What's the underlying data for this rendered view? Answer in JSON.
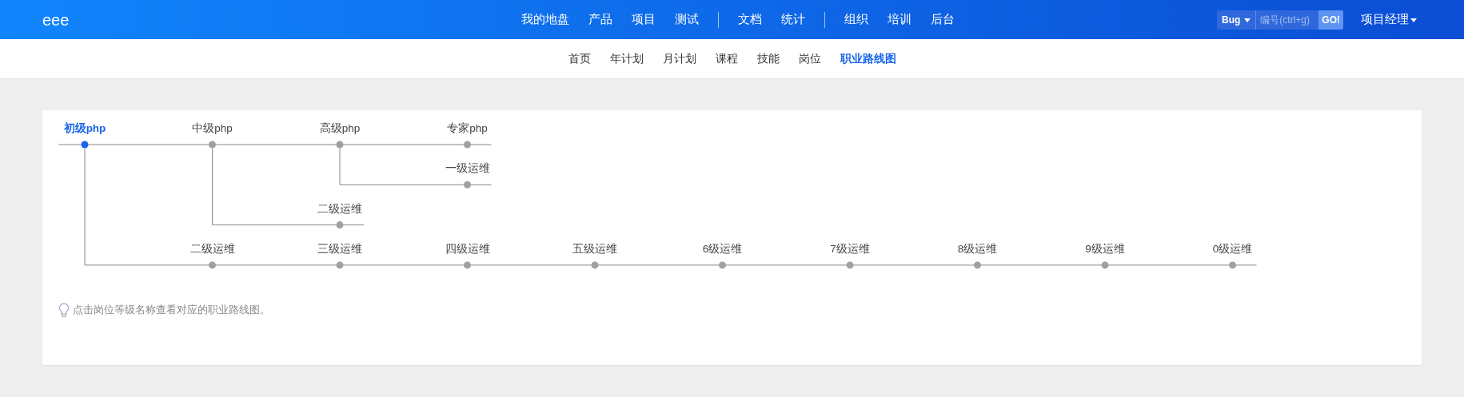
{
  "brand": "eee",
  "main_nav": [
    [
      "我的地盘",
      "产品",
      "项目",
      "测试"
    ],
    [
      "文档",
      "统计"
    ],
    [
      "组织",
      "培训",
      "后台"
    ]
  ],
  "search": {
    "type": "Bug",
    "placeholder": "编号(ctrl+g)",
    "button": "GO!"
  },
  "user_menu": "项目经理",
  "sub_nav": [
    {
      "label": "首页",
      "selected": false
    },
    {
      "label": "年计划",
      "selected": false
    },
    {
      "label": "月计划",
      "selected": false
    },
    {
      "label": "课程",
      "selected": false
    },
    {
      "label": "技能",
      "selected": false
    },
    {
      "label": "岗位",
      "selected": false
    },
    {
      "label": "职业路线图",
      "selected": true
    }
  ],
  "career_map": {
    "root": {
      "label": "初级php",
      "selected": true,
      "children": [
        {
          "label": "中级php",
          "selected": false,
          "children": [
            {
              "label": "高级php",
              "selected": false,
              "children": [
                {
                  "label": "专家php",
                  "selected": false
                },
                {
                  "label": "一级运维",
                  "selected": false
                }
              ]
            },
            {
              "label": "二级运维",
              "selected": false
            }
          ]
        },
        {
          "label": "二级运维",
          "selected": false,
          "children": [
            {
              "label": "三级运维",
              "selected": false,
              "children": [
                {
                  "label": "四级运维",
                  "selected": false,
                  "children": [
                    {
                      "label": "五级运维",
                      "selected": false,
                      "children": [
                        {
                          "label": "6级运维",
                          "selected": false,
                          "children": [
                            {
                              "label": "7级运维",
                              "selected": false,
                              "children": [
                                {
                                  "label": "8级运维",
                                  "selected": false,
                                  "children": [
                                    {
                                      "label": "9级运维",
                                      "selected": false,
                                      "children": [
                                        {
                                          "label": "0级运维",
                                          "selected": false
                                        }
                                      ]
                                    }
                                  ]
                                }
                              ]
                            }
                          ]
                        }
                      ]
                    }
                  ]
                }
              ]
            }
          ]
        }
      ]
    }
  },
  "hint": "点击岗位等级名称查看对应的职业路线图。"
}
